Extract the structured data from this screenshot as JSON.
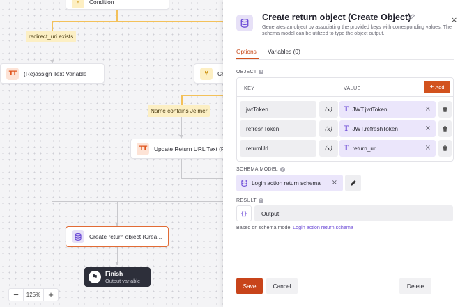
{
  "canvas": {
    "nodes": {
      "condition": "Condition",
      "reassign": "(Re)assign Text Variable",
      "choice": "Ch",
      "update_url": "Update Return URL Text (R",
      "create_return": "Create return object (Crea..."
    },
    "pills": {
      "redirect": "redirect_uri exists",
      "jelmer": "Name contains Jelmer"
    },
    "finish": {
      "title": "Finish",
      "subtitle": "Output variable"
    },
    "zoom": {
      "minus": "−",
      "value": "125%",
      "plus": "+"
    }
  },
  "panel": {
    "title": "Create return object (Create Object)",
    "description": "Generates an object by associating the provided keys with corresponding values. The schema model can be utilized to type the object output.",
    "close": "×",
    "tabs": {
      "options": "Options",
      "variables": "Variables (0)"
    },
    "object": {
      "section_label": "OBJECT",
      "col_key": "KEY",
      "col_value": "VALUE",
      "add_label": "Add",
      "rows": [
        {
          "key": "jwtToken",
          "expr": "(x)",
          "value": "JWT.jwtToken"
        },
        {
          "key": "refreshToken",
          "expr": "(x)",
          "value": "JWT.refreshToken"
        },
        {
          "key": "returnUrl",
          "expr": "(x)",
          "value": "return_url"
        }
      ]
    },
    "schema": {
      "section_label": "SCHEMA MODEL",
      "value": "Login action return schema"
    },
    "result": {
      "section_label": "RESULT",
      "brace": "{}",
      "value": "Output",
      "based_on_prefix": "Based on schema model",
      "based_on_link": "Login action return schema"
    },
    "footer": {
      "save": "Save",
      "cancel": "Cancel",
      "delete": "Delete"
    }
  },
  "colors": {
    "accent": "#d2521e",
    "purple": "#6b4ad6",
    "condition": "#f3c15a"
  }
}
